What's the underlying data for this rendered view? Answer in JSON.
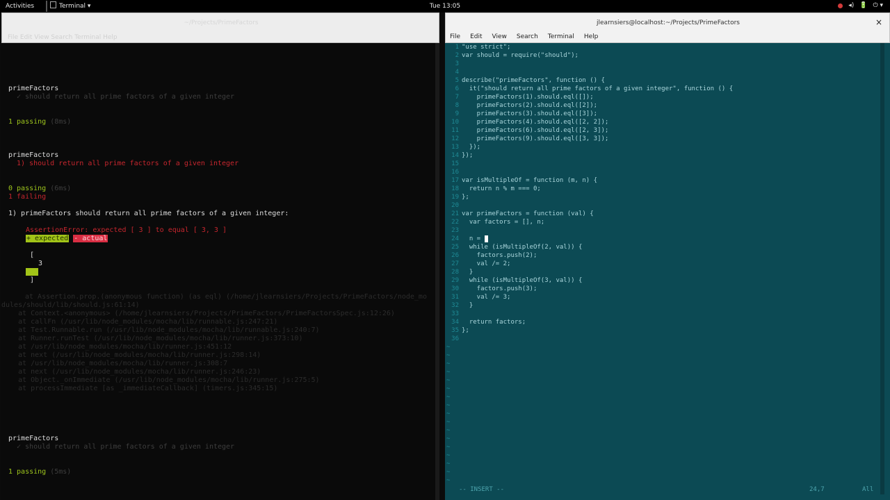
{
  "topbar": {
    "activities": "Activities",
    "app_menu": "Terminal ▾",
    "clock": "Tue 13:05",
    "tray": [
      "●",
      "◂)",
      "🔋",
      "⏻ ▾"
    ]
  },
  "left_window": {
    "faded_title": "~/Projects/PrimeFactors",
    "faded_menu": "File   Edit   View   Search   Terminal   Help"
  },
  "right_window": {
    "title": "jlearnsiers@localhost:~/Projects/PrimeFactors",
    "close": "×",
    "menu": [
      "File",
      "Edit",
      "View",
      "Search",
      "Terminal",
      "Help"
    ]
  },
  "left_terminal": {
    "run1": {
      "suite": "primeFactors",
      "test": "✓ should return all prime factors of a given integer",
      "passing": "1 passing",
      "passing_time": "(8ms)"
    },
    "run2": {
      "suite": "primeFactors",
      "test": "1) should return all prime factors of a given integer",
      "passing": "0 passing",
      "passing_time": "(6ms)",
      "failing": "1 failing",
      "failure_header": "1) primeFactors should return all prime factors of a given integer:",
      "assertion": "AssertionError: expected [ 3 ] to equal [ 3, 3 ]",
      "legend_expected": "+ expected",
      "legend_actual": "- actual",
      "diff_open": "[",
      "diff_line": "3",
      "diff_added": " 3 ",
      "diff_close": "]",
      "stack": [
        "at Assertion.prop.(anonymous function) (as eql) (/home/jlearnsiers/Projects/PrimeFactors/node_mo",
        "dules/should/lib/should.js:61:14)",
        "    at Context.<anonymous> (/home/jlearnsiers/Projects/PrimeFactors/PrimeFactorsSpec.js:12:26)",
        "    at callFn (/usr/lib/node_modules/mocha/lib/runnable.js:247:21)",
        "    at Test.Runnable.run (/usr/lib/node_modules/mocha/lib/runnable.js:240:7)",
        "    at Runner.runTest (/usr/lib/node_modules/mocha/lib/runner.js:373:10)",
        "    at /usr/lib/node_modules/mocha/lib/runner.js:451:12",
        "    at next (/usr/lib/node_modules/mocha/lib/runner.js:298:14)",
        "    at /usr/lib/node_modules/mocha/lib/runner.js:308:7",
        "    at next (/usr/lib/node_modules/mocha/lib/runner.js:246:23)",
        "    at Object._onImmediate (/usr/lib/node_modules/mocha/lib/runner.js:275:5)",
        "    at processImmediate [as _immediateCallback] (timers.js:345:15)"
      ]
    },
    "run3": {
      "suite": "primeFactors",
      "test": "✓ should return all prime factors of a given integer",
      "passing": "1 passing",
      "passing_time": "(5ms)"
    }
  },
  "editor": {
    "lines": [
      "\"use strict\";",
      "var should = require(\"should\");",
      "",
      "",
      "describe(\"primeFactors\", function () {",
      "  it(\"should return all prime factors of a given integer\", function () {",
      "    primeFactors(1).should.eql([]);",
      "    primeFactors(2).should.eql([2]);",
      "    primeFactors(3).should.eql([3]);",
      "    primeFactors(4).should.eql([2, 2]);",
      "    primeFactors(6).should.eql([2, 3]);",
      "    primeFactors(9).should.eql([3, 3]);",
      "  });",
      "});",
      "",
      "",
      "var isMultipleOf = function (m, n) {",
      "  return n % m === 0;",
      "};",
      "",
      "var primeFactors = function (val) {",
      "  var factors = [], n;",
      "",
      "  n = ",
      "  while (isMultipleOf(2, val)) {",
      "    factors.push(2);",
      "    val /= 2;",
      "  }",
      "  while (isMultipleOf(3, val)) {",
      "    factors.push(3);",
      "    val /= 3;",
      "  }",
      "",
      "  return factors;",
      "};",
      ""
    ],
    "tilde": "~",
    "mode": "-- INSERT --",
    "position": "24,7",
    "percent": "All"
  }
}
